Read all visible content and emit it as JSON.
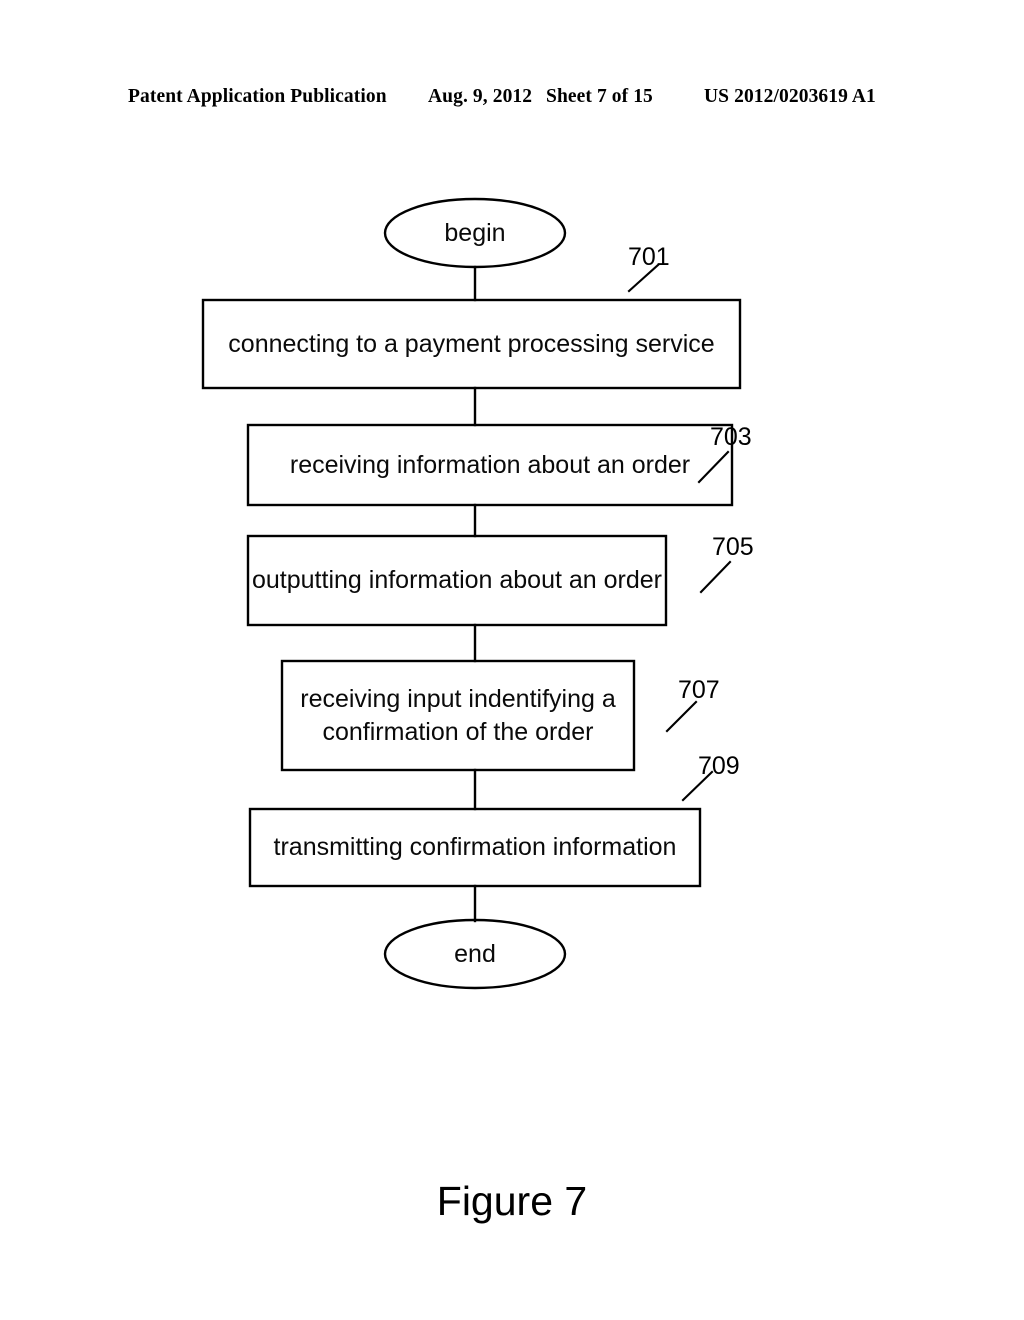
{
  "header": {
    "publication": "Patent Application Publication",
    "date": "Aug. 9, 2012",
    "sheet": "Sheet 7 of 15",
    "patent_number": "US 2012/0203619 A1"
  },
  "figure": {
    "caption": "Figure 7",
    "line_color": "#000000",
    "background_color": "#ffffff"
  },
  "diagram_data": {
    "type": "flowchart",
    "orientation": "vertical",
    "nodes": [
      {
        "id": "begin",
        "shape": "ellipse",
        "label": "begin",
        "ref": ""
      },
      {
        "id": "step701",
        "shape": "rectangle",
        "label": "connecting to a payment processing service",
        "ref": "701"
      },
      {
        "id": "step703",
        "shape": "rectangle",
        "label": "receiving information about an order",
        "ref": "703"
      },
      {
        "id": "step705",
        "shape": "rectangle",
        "label": "outputting information about an order",
        "ref": "705"
      },
      {
        "id": "step707",
        "shape": "rectangle",
        "label": "receiving input indentifying a\nconfirmation of the order",
        "ref": "707"
      },
      {
        "id": "step709",
        "shape": "rectangle",
        "label": "transmitting confirmation information",
        "ref": "709"
      },
      {
        "id": "end",
        "shape": "ellipse",
        "label": "end",
        "ref": ""
      }
    ],
    "edges": [
      {
        "from": "begin",
        "to": "step701"
      },
      {
        "from": "step701",
        "to": "step703"
      },
      {
        "from": "step703",
        "to": "step705"
      },
      {
        "from": "step705",
        "to": "step707"
      },
      {
        "from": "step707",
        "to": "step709"
      },
      {
        "from": "step709",
        "to": "end"
      }
    ],
    "reference_numerals": [
      "701",
      "703",
      "705",
      "707",
      "709"
    ]
  }
}
